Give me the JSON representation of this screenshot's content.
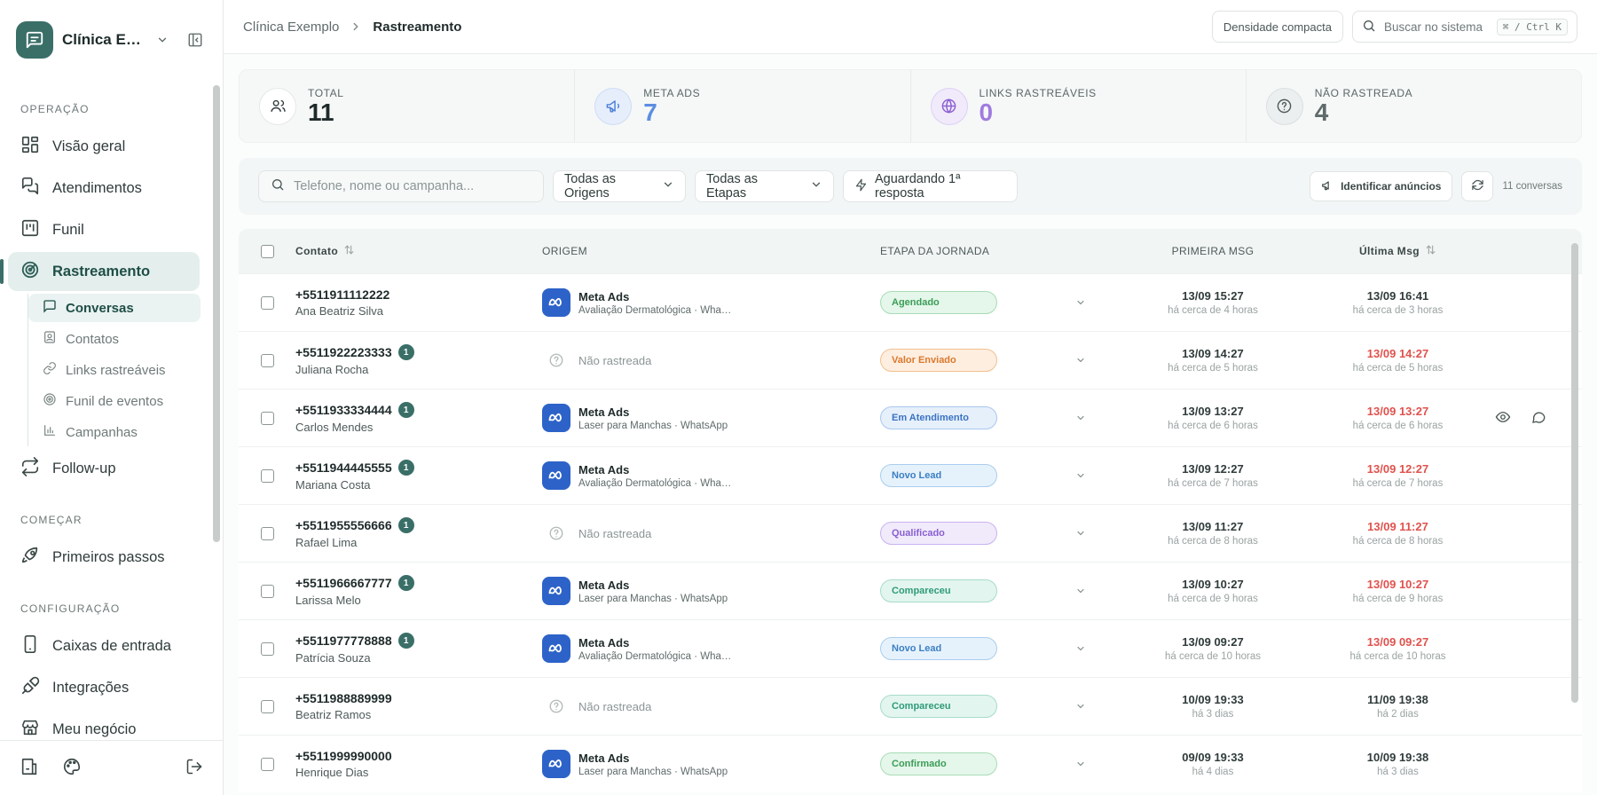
{
  "sidebar": {
    "org_name": "Clínica Exemplo",
    "sections": {
      "operacao": "OPERAÇÃO",
      "comecar": "COMEÇAR",
      "configuracao": "CONFIGURAÇÃO"
    },
    "nav": {
      "visao_geral": "Visão geral",
      "atendimentos": "Atendimentos",
      "funil": "Funil",
      "rastreamento": "Rastreamento",
      "follow_up": "Follow-up",
      "primeiros_passos": "Primeiros passos",
      "caixas": "Caixas de entrada",
      "integracoes": "Integrações",
      "meu_negocio": "Meu negócio"
    },
    "sub": {
      "conversas": "Conversas",
      "contatos": "Contatos",
      "links": "Links rastreáveis",
      "funil_eventos": "Funil de eventos",
      "campanhas": "Campanhas"
    }
  },
  "topbar": {
    "breadcrumb_root": "Clínica Exemplo",
    "breadcrumb_current": "Rastreamento",
    "density_label": "Densidade compacta",
    "search_placeholder": "Buscar no sistema",
    "shortcut": "⌘ / Ctrl K"
  },
  "stats": {
    "total": {
      "label": "TOTAL",
      "value": "11",
      "color": "#1f2a2a"
    },
    "meta": {
      "label": "META ADS",
      "value": "7",
      "color": "#5b8ee0"
    },
    "links": {
      "label": "LINKS RASTREÁVEIS",
      "value": "0",
      "color": "#a07be0"
    },
    "nao": {
      "label": "NÃO RASTREADA",
      "value": "4",
      "color": "#5f6b6a"
    }
  },
  "filters": {
    "search_placeholder": "Telefone, nome ou campanha...",
    "origin": "Todas as Origens",
    "etapa": "Todas as Etapas",
    "awaiting": "Aguardando 1ª resposta",
    "identify": "Identificar anúncios",
    "count": "11 conversas"
  },
  "table": {
    "headers": {
      "contato": "Contato",
      "origem": "ORIGEM",
      "etapa": "ETAPA DA JORNADA",
      "primeira": "PRIMEIRA MSG",
      "ultima": "Última Msg"
    },
    "rows": [
      {
        "phone": "+5511911112222",
        "badge": "",
        "name": "Ana Beatriz Silva",
        "origin_title": "Meta Ads",
        "origin_sub": "Avaliação Dermatológica · WhatsApp",
        "stage": "Agendado",
        "first_date": "13/09 15:27",
        "first_ago": "há cerca de 4 horas",
        "last_date": "13/09 16:41",
        "last_ago": "há cerca de 3 horas"
      },
      {
        "phone": "+5511922223333",
        "badge": "1",
        "name": "Juliana Rocha",
        "origin_title": "Não rastreada",
        "origin_sub": "",
        "stage": "Valor Enviado",
        "first_date": "13/09 14:27",
        "first_ago": "há cerca de 5 horas",
        "last_date": "13/09 14:27",
        "last_ago": "há cerca de 5 horas"
      },
      {
        "phone": "+5511933334444",
        "badge": "1",
        "name": "Carlos Mendes",
        "origin_title": "Meta Ads",
        "origin_sub": "Laser para Manchas · WhatsApp",
        "stage": "Em Atendimento",
        "first_date": "13/09 13:27",
        "first_ago": "há cerca de 6 horas",
        "last_date": "13/09 13:27",
        "last_ago": "há cerca de 6 horas"
      },
      {
        "phone": "+5511944445555",
        "badge": "1",
        "name": "Mariana Costa",
        "origin_title": "Meta Ads",
        "origin_sub": "Avaliação Dermatológica · WhatsApp",
        "stage": "Novo Lead",
        "first_date": "13/09 12:27",
        "first_ago": "há cerca de 7 horas",
        "last_date": "13/09 12:27",
        "last_ago": "há cerca de 7 horas"
      },
      {
        "phone": "+5511955556666",
        "badge": "1",
        "name": "Rafael Lima",
        "origin_title": "Não rastreada",
        "origin_sub": "",
        "stage": "Qualificado",
        "first_date": "13/09 11:27",
        "first_ago": "há cerca de 8 horas",
        "last_date": "13/09 11:27",
        "last_ago": "há cerca de 8 horas"
      },
      {
        "phone": "+5511966667777",
        "badge": "1",
        "name": "Larissa Melo",
        "origin_title": "Meta Ads",
        "origin_sub": "Laser para Manchas · WhatsApp",
        "stage": "Compareceu",
        "first_date": "13/09 10:27",
        "first_ago": "há cerca de 9 horas",
        "last_date": "13/09 10:27",
        "last_ago": "há cerca de 9 horas"
      },
      {
        "phone": "+5511977778888",
        "badge": "1",
        "name": "Patrícia Souza",
        "origin_title": "Meta Ads",
        "origin_sub": "Avaliação Dermatológica · WhatsApp",
        "stage": "Novo Lead",
        "first_date": "13/09 09:27",
        "first_ago": "há cerca de 10 horas",
        "last_date": "13/09 09:27",
        "last_ago": "há cerca de 10 horas"
      },
      {
        "phone": "+5511988889999",
        "badge": "",
        "name": "Beatriz Ramos",
        "origin_title": "Não rastreada",
        "origin_sub": "",
        "stage": "Compareceu",
        "first_date": "10/09 19:33",
        "first_ago": "há 3 dias",
        "last_date": "11/09 19:38",
        "last_ago": "há 2 dias"
      },
      {
        "phone": "+5511999990000",
        "badge": "",
        "name": "Henrique Dias",
        "origin_title": "Meta Ads",
        "origin_sub": "Laser para Manchas · WhatsApp",
        "stage": "Confirmado",
        "first_date": "09/09 19:33",
        "first_ago": "há 4 dias",
        "last_date": "10/09 19:38",
        "last_ago": "há 3 dias"
      }
    ]
  },
  "stage_colors": {
    "Agendado": {
      "bg": "#e5f6ea",
      "border": "#a8dcb6",
      "text": "#3a9d57"
    },
    "Valor Enviado": {
      "bg": "#fdeee0",
      "border": "#f3bf8f",
      "text": "#d9792d"
    },
    "Em Atendimento": {
      "bg": "#e6f0fb",
      "border": "#a9c7ee",
      "text": "#3b73c4"
    },
    "Novo Lead": {
      "bg": "#e6f2fb",
      "border": "#a9cdee",
      "text": "#3b7fc4"
    },
    "Qualificado": {
      "bg": "#f0eafb",
      "border": "#c8b3ee",
      "text": "#8a5fd0"
    },
    "Compareceu": {
      "bg": "#e3f5ef",
      "border": "#a5dcc8",
      "text": "#2f9b78"
    },
    "Confirmado": {
      "bg": "#e5f6ea",
      "border": "#a8dcb6",
      "text": "#3a9d57"
    }
  },
  "colors": {
    "accent": "#3a6f68",
    "meta_blue": "#2d63c8",
    "overdue_red": "#e0524d"
  }
}
